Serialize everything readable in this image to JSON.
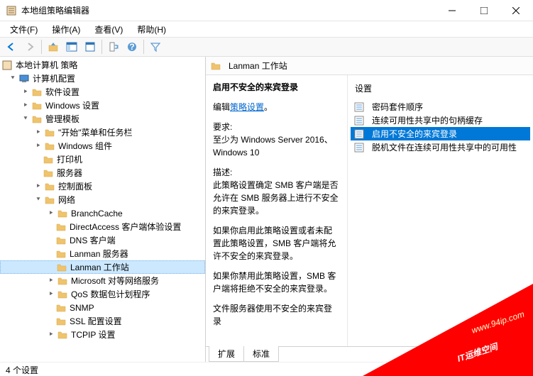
{
  "window": {
    "title": "本地组策略编辑器"
  },
  "menu": {
    "file": "文件(F)",
    "action": "操作(A)",
    "view": "查看(V)",
    "help": "帮助(H)"
  },
  "tree": {
    "root": "本地计算机 策略",
    "computer": "计算机配置",
    "software": "软件设置",
    "windows": "Windows 设置",
    "admin": "管理模板",
    "start": "\"开始\"菜单和任务栏",
    "wincomp": "Windows 组件",
    "printer": "打印机",
    "server": "服务器",
    "cpanel": "控制面板",
    "network": "网络",
    "branch": "BranchCache",
    "direct": "DirectAccess 客户端体验设置",
    "dns": "DNS 客户端",
    "lanmansrv": "Lanman 服务器",
    "lanmanwks": "Lanman 工作站",
    "msp2p": "Microsoft 对等网络服务",
    "qos": "QoS 数据包计划程序",
    "snmp": "SNMP",
    "ssl": "SSL 配置设置",
    "tcpip": "TCPIP 设置"
  },
  "breadcrumb": {
    "location": "Lanman 工作站"
  },
  "detail": {
    "title": "启用不安全的来宾登录",
    "editlink_pre": "编辑",
    "editlink": "策略设置",
    "req_label": "要求:",
    "req_text": "至少为 Windows Server 2016、Windows 10",
    "desc_label": "描述:",
    "desc_p1": "此策略设置确定 SMB 客户端是否允许在 SMB 服务器上进行不安全的来宾登录。",
    "desc_p2": "如果你启用此策略设置或者未配置此策略设置，SMB 客户端将允许不安全的来宾登录。",
    "desc_p3": "如果你禁用此策略设置，SMB 客户端将拒绝不安全的来宾登录。",
    "desc_p4": "文件服务器使用不安全的来宾登录"
  },
  "settings": {
    "header": "设置",
    "items": [
      "密码套件顺序",
      "连续可用性共享中的句柄缓存",
      "启用不安全的来宾登录",
      "脱机文件在连续可用性共享中的可用性"
    ]
  },
  "tabs": {
    "extended": "扩展",
    "standard": "标准"
  },
  "status": "4 个设置",
  "watermark": {
    "url": "www.94ip.com",
    "text": "IT运维空间"
  }
}
